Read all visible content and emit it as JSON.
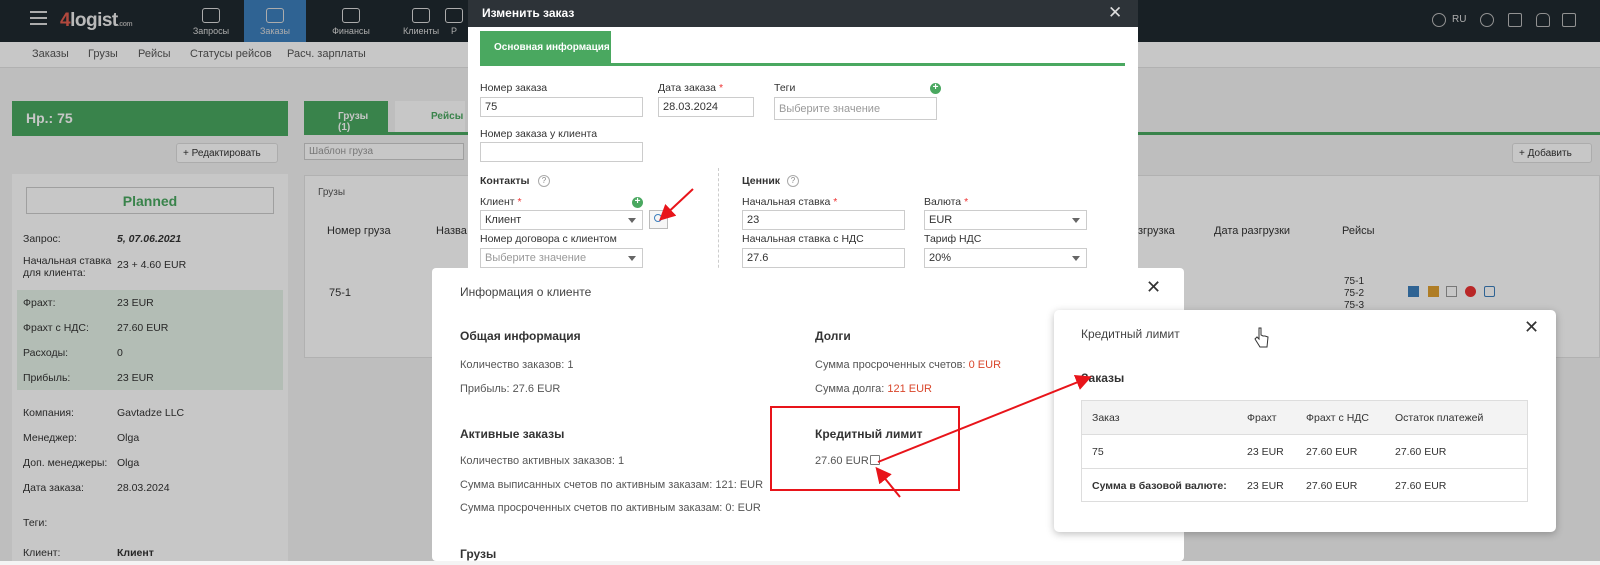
{
  "app": {
    "logo_main": "4",
    "logo_text": "logist",
    "logo_suffix": ".com",
    "lang": "RU"
  },
  "nav": [
    {
      "label": "Запросы",
      "icon": "chat-icon"
    },
    {
      "label": "Заказы",
      "icon": "box-icon"
    },
    {
      "label": "Финансы",
      "icon": "money-bag-icon"
    },
    {
      "label": "Клиенты",
      "icon": "users-icon"
    },
    {
      "label": "Р",
      "icon": "truck-icon"
    }
  ],
  "submenu": [
    "Заказы",
    "Грузы",
    "Рейсы",
    "Статусы рейсов",
    "Расч. зарплаты"
  ],
  "left": {
    "title": "Нр.: 75",
    "edit": "+ Редактировать",
    "status": "Planned",
    "rows": [
      {
        "k": "Запрос:",
        "v": "5, 07.06.2021"
      },
      {
        "k": "Начальная ставка для клиента:",
        "v": "23 + 4.60 EUR"
      },
      {
        "k": "Фрахт:",
        "v": "23 EUR"
      },
      {
        "k": "Фрахт с НДС:",
        "v": "27.60 EUR"
      },
      {
        "k": "Расходы:",
        "v": "0"
      },
      {
        "k": "Прибыль:",
        "v": "23 EUR"
      },
      {
        "k": "Компания:",
        "v": "Gavtadze LLC"
      },
      {
        "k": "Менеджер:",
        "v": "Olga"
      },
      {
        "k": "Доп. менеджеры:",
        "v": "Olga"
      },
      {
        "k": "Дата заказа:",
        "v": "28.03.2024"
      },
      {
        "k": "Теги:",
        "v": ""
      },
      {
        "k": "Клиент:",
        "v": "Клиент"
      }
    ]
  },
  "middle": {
    "tab_cargo": "Грузы (1)",
    "tab_trips": "Рейсы",
    "template_ph": "Шаблон груза",
    "add": "+ Добавить",
    "section": "Грузы",
    "headers": [
      "Номер груза",
      "Назва",
      "згрузка",
      "Дата разгрузки",
      "Рейсы"
    ],
    "row_id": "75-1",
    "trips": [
      "75-1",
      "75-2",
      "75-3"
    ]
  },
  "edit_modal": {
    "title": "Изменить заказ",
    "tab": "Основная информация",
    "order_no_label": "Номер заказа",
    "order_no": "75",
    "order_date_label": "Дата заказа",
    "order_date": "28.03.2024",
    "tags_label": "Теги",
    "tags_ph": "Выберите значение",
    "client_order_label": "Номер заказа у клиента",
    "contacts": "Контакты",
    "client_label": "Клиент",
    "client_value": "Клиент",
    "contract_label": "Номер договора с клиентом",
    "contract_ph": "Выберите значение",
    "price": "Ценник",
    "rate_label": "Начальная ставка",
    "rate": "23",
    "currency_label": "Валюта",
    "currency": "EUR",
    "rate_vat_label": "Начальная ставка с НДС",
    "rate_vat": "27.6",
    "vat_label": "Тариф НДС",
    "vat": "20%"
  },
  "client_modal": {
    "title": "Информация о клиенте",
    "general": "Общая информация",
    "orders_count": "Количество заказов: 1",
    "profit": "Прибыль: 27.6 EUR",
    "active": "Активные заказы",
    "active_count": "Количество активных заказов: 1",
    "active_invoiced": "Сумма выписанных счетов по активным заказам: 121: EUR",
    "active_overdue": "Сумма просроченных счетов по активным заказам: 0: EUR",
    "cargo": "Грузы",
    "debts": "Долги",
    "overdue_label": "Сумма просроченных счетов: ",
    "overdue_value": "0 EUR",
    "debt_label": "Сумма долга: ",
    "debt_value": "121 EUR",
    "credit": "Кредитный лимит",
    "credit_value": "27.60 EUR"
  },
  "credit_modal": {
    "title": "Кредитный лимит",
    "section": "Заказы",
    "headers": [
      "Заказ",
      "Фрахт",
      "Фрахт с НДС",
      "Остаток платежей"
    ],
    "rows": [
      [
        "75",
        "23 EUR",
        "27.60 EUR",
        "27.60 EUR"
      ],
      [
        "Сумма в базовой валюте:",
        "23 EUR",
        "27.60 EUR",
        "27.60 EUR"
      ]
    ]
  },
  "colors": {
    "accent_green": "#4aa860",
    "nav_active": "#3d7fbd",
    "annotation_red": "#e8141a"
  }
}
